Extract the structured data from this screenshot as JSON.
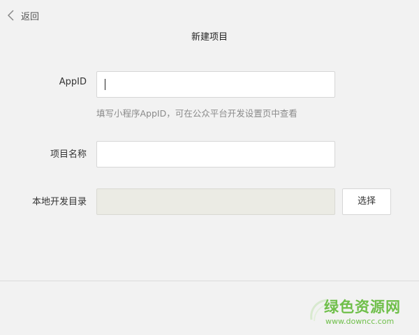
{
  "header": {
    "back_label": "返回",
    "back_icon": "chevron-left-icon",
    "title": "新建项目"
  },
  "form": {
    "appid": {
      "label": "AppID",
      "value": "",
      "placeholder": "",
      "hint": "填写小程序AppID，可在公众平台开发设置页中查看"
    },
    "project_name": {
      "label": "项目名称",
      "value": "",
      "placeholder": ""
    },
    "local_dir": {
      "label": "本地开发目录",
      "value": "",
      "button_label": "选择"
    }
  },
  "watermark": {
    "text": "绿色资源网",
    "url": "www.downcc.com",
    "color": "#6fbf4a"
  },
  "colors": {
    "background": "#f2f2f2",
    "disabled_field": "#ebebe4"
  }
}
